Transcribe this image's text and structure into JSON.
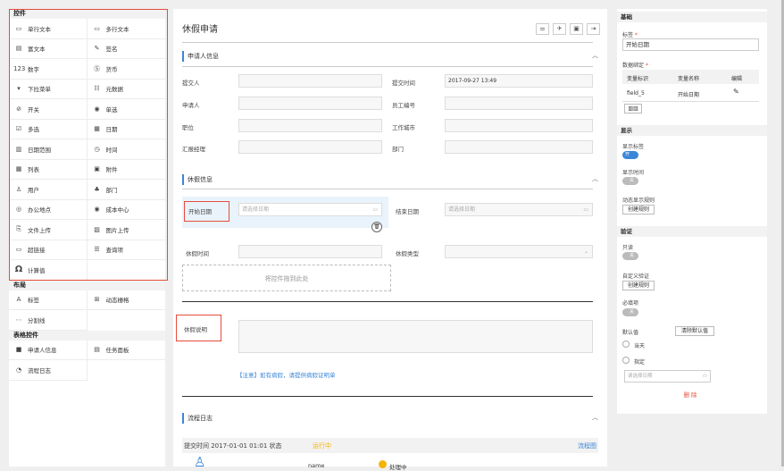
{
  "left": {
    "section_controls": "控件",
    "controls": [
      {
        "icon": "textbox-icon",
        "glyph": "▭",
        "label": "单行文本"
      },
      {
        "icon": "textarea-icon",
        "glyph": "▭",
        "label": "多行文本"
      },
      {
        "icon": "richtext-icon",
        "glyph": "▤",
        "label": "富文本"
      },
      {
        "icon": "signature-icon",
        "glyph": "✎",
        "label": "签名"
      },
      {
        "icon": "number-icon",
        "glyph": "123",
        "label": "数字"
      },
      {
        "icon": "currency-icon",
        "glyph": "Ⓢ",
        "label": "货币"
      },
      {
        "icon": "dropdown-icon",
        "glyph": "▾",
        "label": "下拉菜单"
      },
      {
        "icon": "metadata-icon",
        "glyph": "☷",
        "label": "元数据"
      },
      {
        "icon": "switch-icon",
        "glyph": "⊘",
        "label": "开关"
      },
      {
        "icon": "radio-icon",
        "glyph": "◉",
        "label": "单选"
      },
      {
        "icon": "checkbox-icon",
        "glyph": "☑",
        "label": "多选"
      },
      {
        "icon": "calendar-icon",
        "glyph": "▦",
        "label": "日期"
      },
      {
        "icon": "date-range-icon",
        "glyph": "▥",
        "label": "日期范围"
      },
      {
        "icon": "clock-icon",
        "glyph": "◷",
        "label": "时间"
      },
      {
        "icon": "table-icon",
        "glyph": "▦",
        "label": "列表"
      },
      {
        "icon": "attachment-icon",
        "glyph": "▣",
        "label": "附件"
      },
      {
        "icon": "user-icon",
        "glyph": "♙",
        "label": "用户"
      },
      {
        "icon": "department-icon",
        "glyph": "♣",
        "label": "部门"
      },
      {
        "icon": "location-icon",
        "glyph": "◎",
        "label": "办公地点"
      },
      {
        "icon": "cost-center-icon",
        "glyph": "◉",
        "label": "成本中心"
      },
      {
        "icon": "file-upload-icon",
        "glyph": "⎘",
        "label": "文件上传"
      },
      {
        "icon": "image-upload-icon",
        "glyph": "▨",
        "label": "图片上传"
      },
      {
        "icon": "hyperlink-icon",
        "glyph": "▭",
        "label": "超链接"
      },
      {
        "icon": "lookup-icon",
        "glyph": "☰",
        "label": "查询项"
      },
      {
        "icon": "omega-icon",
        "glyph": "Ω",
        "label": "计算值"
      }
    ],
    "section_layout": "布局",
    "layout": [
      {
        "icon": "label-icon",
        "glyph": "A",
        "label": "标签"
      },
      {
        "icon": "dynamic-grid-icon",
        "glyph": "⊞",
        "label": "动态栅格"
      },
      {
        "icon": "divider-icon",
        "glyph": "⋯",
        "label": "分割线"
      }
    ],
    "section_table": "表格控件",
    "table": [
      {
        "icon": "applicant-info-icon",
        "glyph": "■",
        "label": "申请人信息"
      },
      {
        "icon": "task-panel-icon",
        "glyph": "▤",
        "label": "任务面板"
      },
      {
        "icon": "flow-log-icon",
        "glyph": "◔",
        "label": "流程日志"
      }
    ]
  },
  "center": {
    "title": "休假申请",
    "sec1": "申请人信息",
    "sec1_fields": {
      "submitter": "提交人",
      "submit_time": "提交时间",
      "submit_time_val": "2017-09-27 13:49",
      "applicant": "申请人",
      "emp_no": "员工编号",
      "position": "职位",
      "city": "工作城市",
      "manager": "汇报经理",
      "dept": "部门"
    },
    "sec2": "休假信息",
    "start_date": "开始日期",
    "start_ph": "请选择日期",
    "end_date": "结束日期",
    "end_ph": "请选择日期",
    "leave_time": "休假时间",
    "leave_type": "休假类型",
    "drop_hint": "将控件拖到此处",
    "leave_desc": "休假说明",
    "note": "【注意】如有病假，请提供病假证明单",
    "sec3": "流程日志",
    "log_submit": "提交时间 2017-01-01 01:01 状态",
    "log_status": "运行中",
    "log_link": "流程图",
    "log_name": "name",
    "log_processing": "处理中"
  },
  "right": {
    "sec_basic": "基础",
    "label": "标签",
    "label_val": "开始日期",
    "binding": "数据绑定",
    "col_var": "变量标识",
    "col_name": "变量名称",
    "col_edit": "编辑",
    "row_var": "field_5",
    "row_name": "开始日期",
    "sec_display": "显示",
    "show_label": "显示标签",
    "toggle_on": "开",
    "show_time": "显示时间",
    "toggle_off": "关",
    "dynamic_rule": "动态显示规则",
    "create_rule": "创建规则",
    "sec_validate": "验证",
    "readonly": "只读",
    "custom_validate": "自定义验证",
    "create_rule2": "创建规则",
    "required": "必填项",
    "default": "默认值",
    "clear_default": "清除默认值",
    "today": "当天",
    "specified": "指定",
    "date_ph": "请选择日期",
    "delete": "删 除",
    "accent": "#3b86d8",
    "danger": "#e74c3c",
    "orange": "#f5b400"
  }
}
